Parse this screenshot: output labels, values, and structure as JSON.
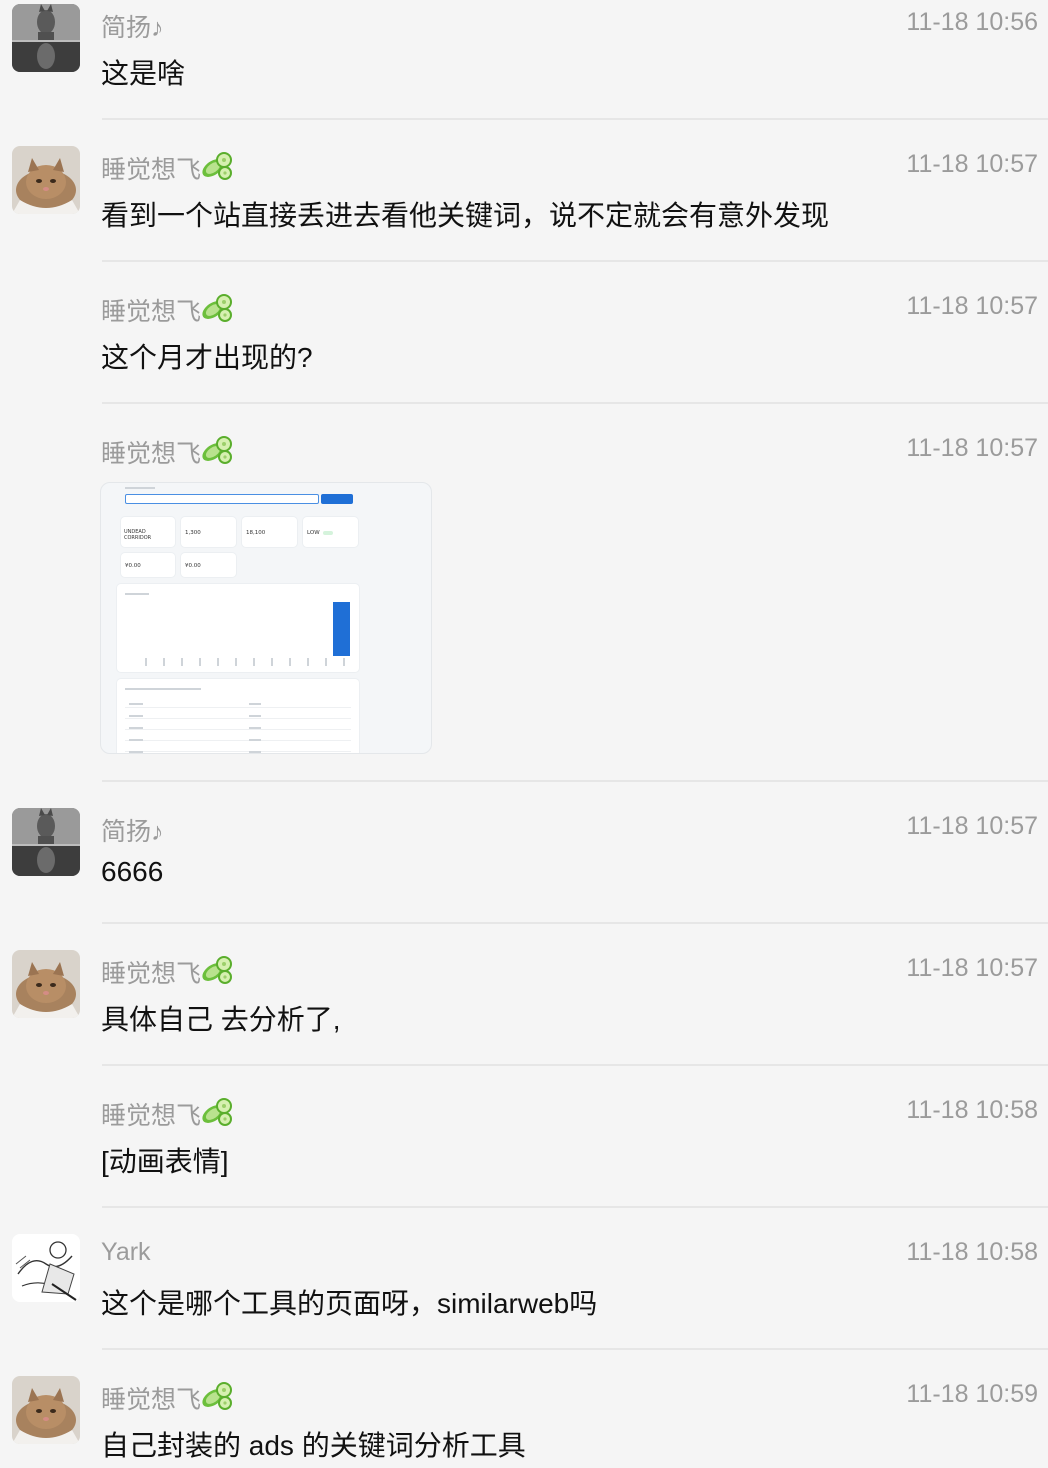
{
  "messages": [
    {
      "sender": "简扬♪",
      "time": "11-18 10:56",
      "text": "这是啥"
    },
    {
      "sender": "睡觉想飞",
      "time": "11-18 10:57",
      "text": "看到一个站直接丢进去看他关键词，说不定就会有意外发现"
    },
    {
      "sender": "睡觉想飞",
      "time": "11-18 10:57",
      "text": "这个月才出现的?"
    },
    {
      "sender": "睡觉想飞",
      "time": "11-18 10:57",
      "image": {
        "keyword_title": "UNDEAD\nCORRIDOR",
        "keyword_title_line1": "UNDEAD",
        "keyword_title_line2": "CORRIDOR",
        "stat_1": "1,300",
        "stat_2": "18,100",
        "stat_3": "LOW",
        "price_1": "¥0.00",
        "price_2": "¥0.00"
      }
    },
    {
      "sender": "简扬♪",
      "time": "11-18 10:57",
      "text": "6666"
    },
    {
      "sender": "睡觉想飞",
      "time": "11-18 10:57",
      "text": "具体自己 去分析了,"
    },
    {
      "sender": "睡觉想飞",
      "time": "11-18 10:58",
      "text": "[动画表情]"
    },
    {
      "sender": "Yark",
      "time": "11-18 10:58",
      "text": "这个是哪个工具的页面呀，similarweb吗"
    },
    {
      "sender": "睡觉想飞",
      "time": "11-18 10:59",
      "text": "自己封装的 ads 的关键词分析工具"
    }
  ],
  "badge_icon": "cucumber-icon",
  "colors": {
    "background": "#f5f5f5",
    "meta_text": "#9b9b9b",
    "body_text": "#111111",
    "chart_bar": "#1f6fd6"
  }
}
